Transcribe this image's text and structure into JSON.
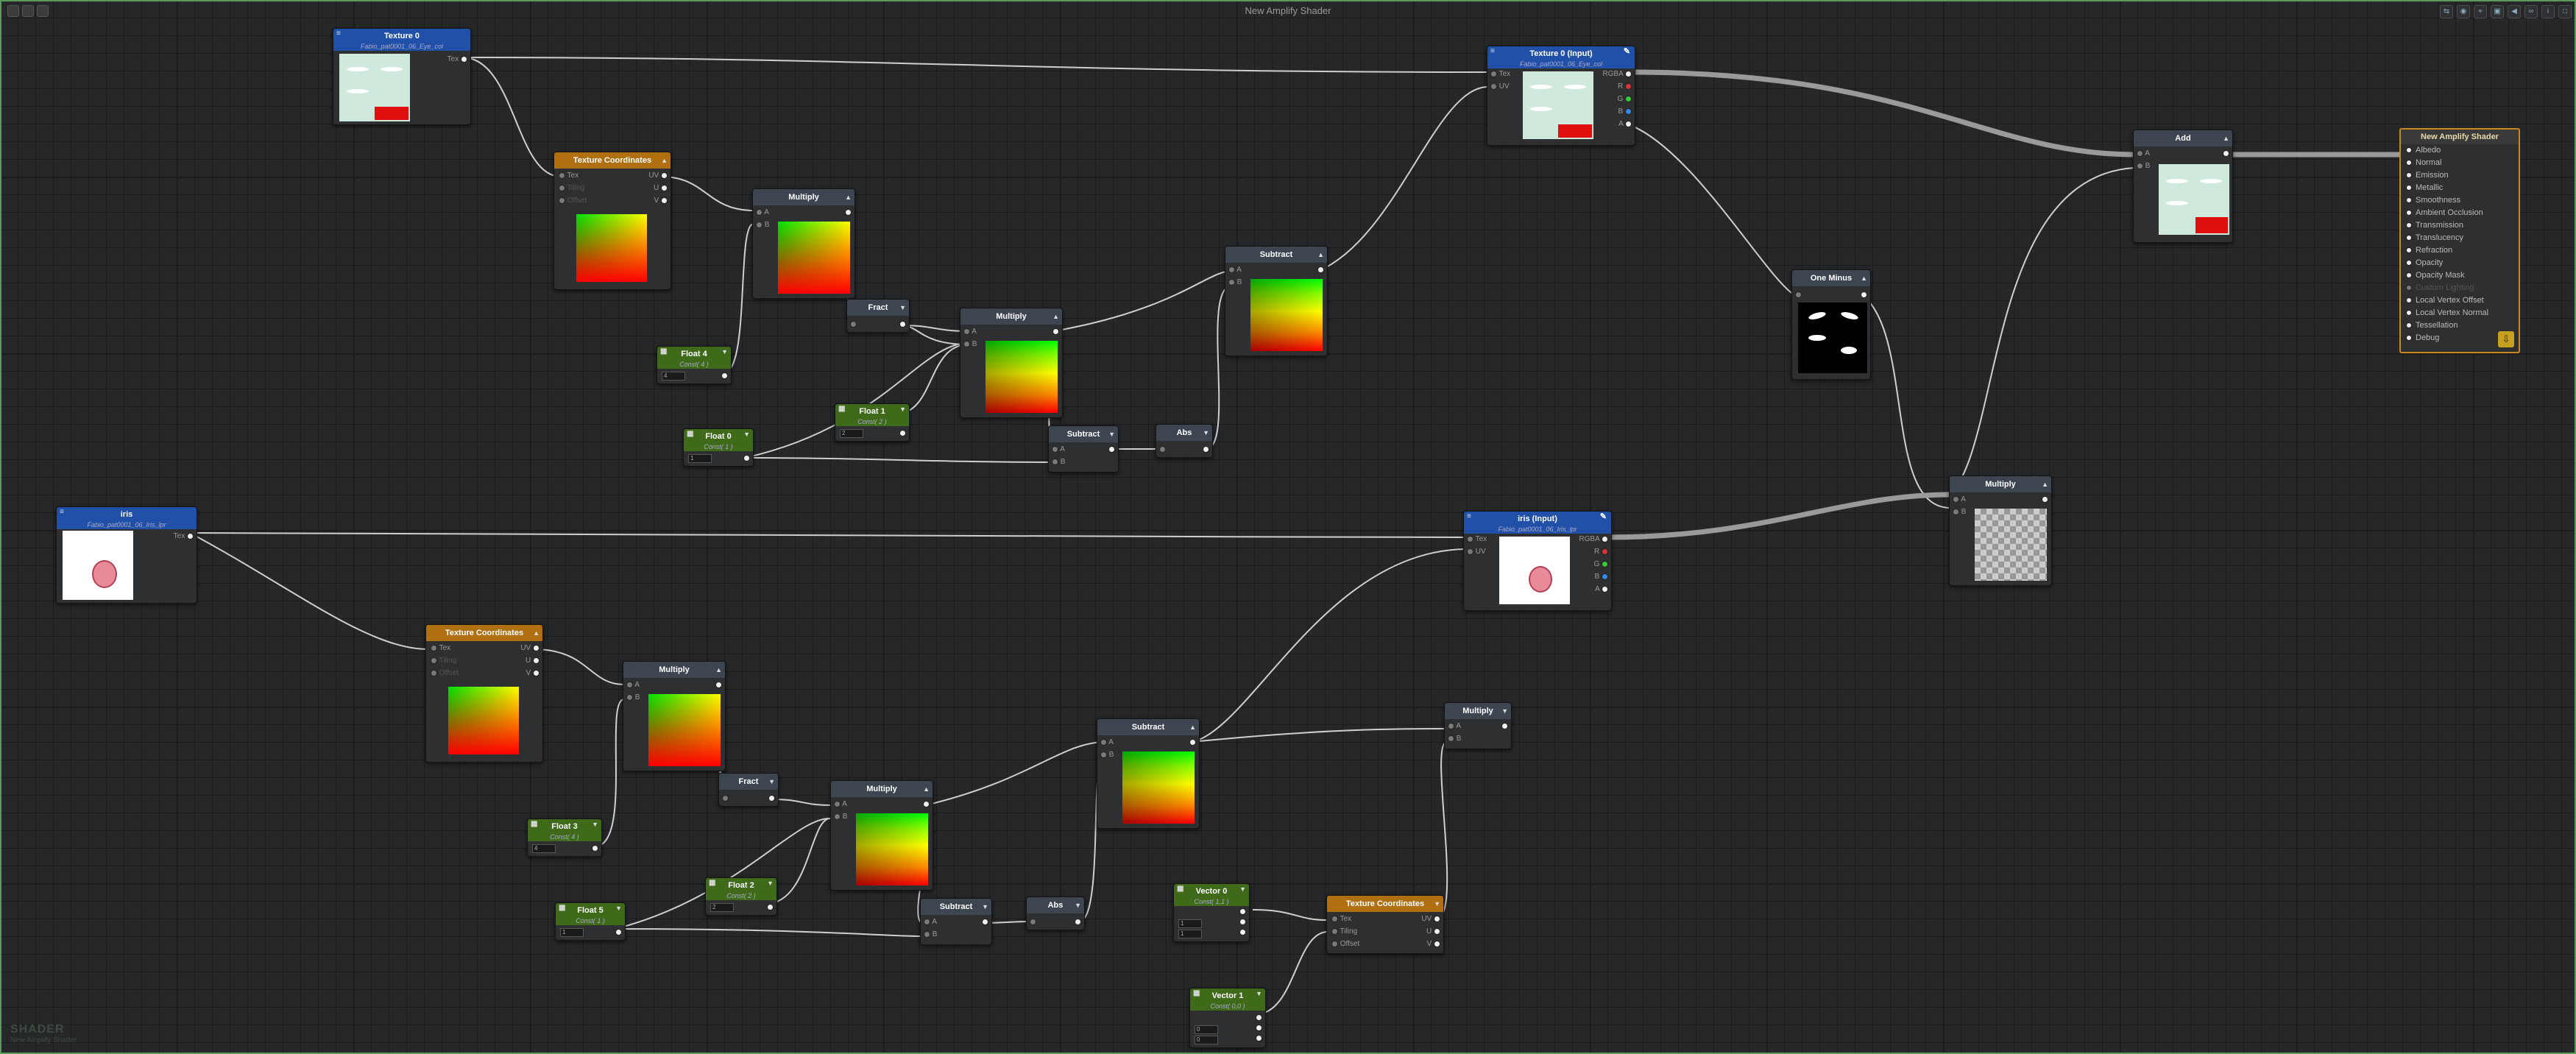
{
  "window": {
    "title": "New Amplify Shader"
  },
  "logo": {
    "label": "SHADER",
    "subtitle": "New Amplify Shader"
  },
  "nodes": {
    "texture0": {
      "title": "Texture 0",
      "subtitle": "Fabio_pat0001_06_Eye_col",
      "out": "Tex"
    },
    "texcoords1": {
      "title": "Texture Coordinates",
      "in1": "Tex",
      "in2": "Tiling",
      "in3": "Offset",
      "o1": "UV",
      "o2": "U",
      "o3": "V"
    },
    "multiply1": {
      "title": "Multiply",
      "a": "A",
      "b": "B"
    },
    "float4": {
      "title": "Float 4",
      "sub": "Const( 4 )",
      "val": "4"
    },
    "fract1": {
      "title": "Fract"
    },
    "multiply2": {
      "title": "Multiply",
      "a": "A",
      "b": "B"
    },
    "float1": {
      "title": "Float 1",
      "sub": "Const( 2 )",
      "val": "2"
    },
    "float0": {
      "title": "Float 0",
      "sub": "Const( 1 )",
      "val": "1"
    },
    "subtract1": {
      "title": "Subtract",
      "a": "A",
      "b": "B"
    },
    "subtract2": {
      "title": "Subtract",
      "a": "A",
      "b": "B"
    },
    "abs1": {
      "title": "Abs"
    },
    "texture0input": {
      "title": "Texture 0 (Input)",
      "subtitle": "Fabio_pat0001_06_Eye_col",
      "tex": "Tex",
      "uv": "UV",
      "rgba": "RGBA",
      "r": "R",
      "g": "G",
      "b": "B",
      "a": "A"
    },
    "add": {
      "title": "Add",
      "a": "A",
      "b": "B"
    },
    "oneminus": {
      "title": "One Minus"
    },
    "multiply3": {
      "title": "Multiply",
      "a": "A",
      "b": "B"
    },
    "iris": {
      "title": "iris",
      "subtitle": "Fabio_pat0001_06_Iris_lpr",
      "out": "Tex"
    },
    "irisinput": {
      "title": "iris (Input)",
      "subtitle": "Fabio_pat0001_06_Iris_lpr",
      "tex": "Tex",
      "uv": "UV",
      "rgba": "RGBA",
      "r": "R",
      "g": "G",
      "b": "B",
      "a": "A"
    },
    "texcoords2": {
      "title": "Texture Coordinates",
      "in1": "Tex",
      "in2": "Tiling",
      "in3": "Offset",
      "o1": "UV",
      "o2": "U",
      "o3": "V"
    },
    "multiply4": {
      "title": "Multiply",
      "a": "A",
      "b": "B"
    },
    "fract2": {
      "title": "Fract"
    },
    "float3": {
      "title": "Float 3",
      "sub": "Const( 4 )",
      "val": "4"
    },
    "multiply5": {
      "title": "Multiply",
      "a": "A",
      "b": "B"
    },
    "float2": {
      "title": "Float 2",
      "sub": "Const( 2 )",
      "val": "2"
    },
    "float5": {
      "title": "Float 5",
      "sub": "Const( 1 )",
      "val": "1"
    },
    "subtract3": {
      "title": "Subtract",
      "a": "A",
      "b": "B"
    },
    "subtract4": {
      "title": "Subtract",
      "a": "A",
      "b": "B"
    },
    "abs2": {
      "title": "Abs"
    },
    "multiply6": {
      "title": "Multiply",
      "a": "A",
      "b": "B"
    },
    "vector0": {
      "title": "Vector 0",
      "sub": "Const( 1,1 )",
      "x": "1",
      "y": "1"
    },
    "texcoords3": {
      "title": "Texture Coordinates",
      "in1": "Tex",
      "in2": "Tiling",
      "in3": "Offset",
      "o1": "UV",
      "o2": "U",
      "o3": "V"
    },
    "vector1": {
      "title": "Vector 1",
      "sub": "Const( 0,0 )",
      "x": "0",
      "y": "0"
    }
  },
  "master": {
    "title": "New Amplify Shader",
    "inputs": [
      "Albedo",
      "Normal",
      "Emission",
      "Metallic",
      "Smoothness",
      "Ambient Occlusion",
      "Transmission",
      "Translucency",
      "Refraction",
      "Opacity",
      "Opacity Mask",
      "Custom Lighting",
      "Local Vertex Offset",
      "Local Vertex Normal",
      "Tessellation",
      "Debug"
    ]
  }
}
